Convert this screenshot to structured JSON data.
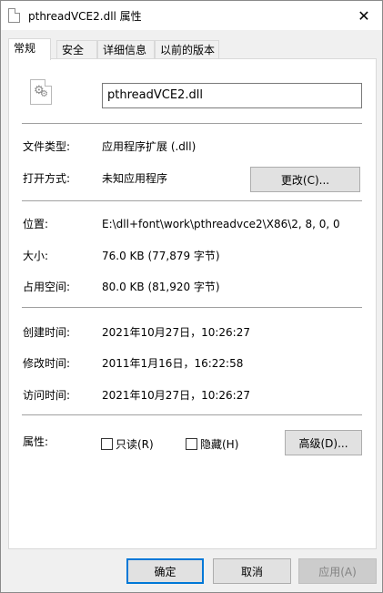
{
  "window": {
    "title": "pthreadVCE2.dll 属性",
    "close_glyph": "✕"
  },
  "tabs": [
    {
      "label": "常规",
      "active": true
    },
    {
      "label": "安全",
      "active": false
    },
    {
      "label": "详细信息",
      "active": false
    },
    {
      "label": "以前的版本",
      "active": false
    }
  ],
  "general": {
    "file_name": "pthreadVCE2.dll",
    "file_type_label": "文件类型:",
    "file_type_value": "应用程序扩展 (.dll)",
    "opens_with_label": "打开方式:",
    "opens_with_value": "未知应用程序",
    "change_button": "更改(C)...",
    "location_label": "位置:",
    "location_value": "E:\\dll+font\\work\\pthreadvce2\\X86\\2, 8, 0, 0",
    "size_label": "大小:",
    "size_value": "76.0 KB (77,879 字节)",
    "size_on_disk_label": "占用空间:",
    "size_on_disk_value": "80.0 KB (81,920 字节)",
    "created_label": "创建时间:",
    "created_value": "2021年10月27日，10:26:27",
    "modified_label": "修改时间:",
    "modified_value": "2011年1月16日，16:22:58",
    "accessed_label": "访问时间:",
    "accessed_value": "2021年10月27日，10:26:27",
    "attributes_label": "属性:",
    "readonly_label": "只读(R)",
    "hidden_label": "隐藏(H)",
    "advanced_button": "高级(D)..."
  },
  "footer": {
    "ok": "确定",
    "cancel": "取消",
    "apply": "应用(A)"
  },
  "icons": {
    "file": "dll-file-icon",
    "gear": "⚙"
  }
}
